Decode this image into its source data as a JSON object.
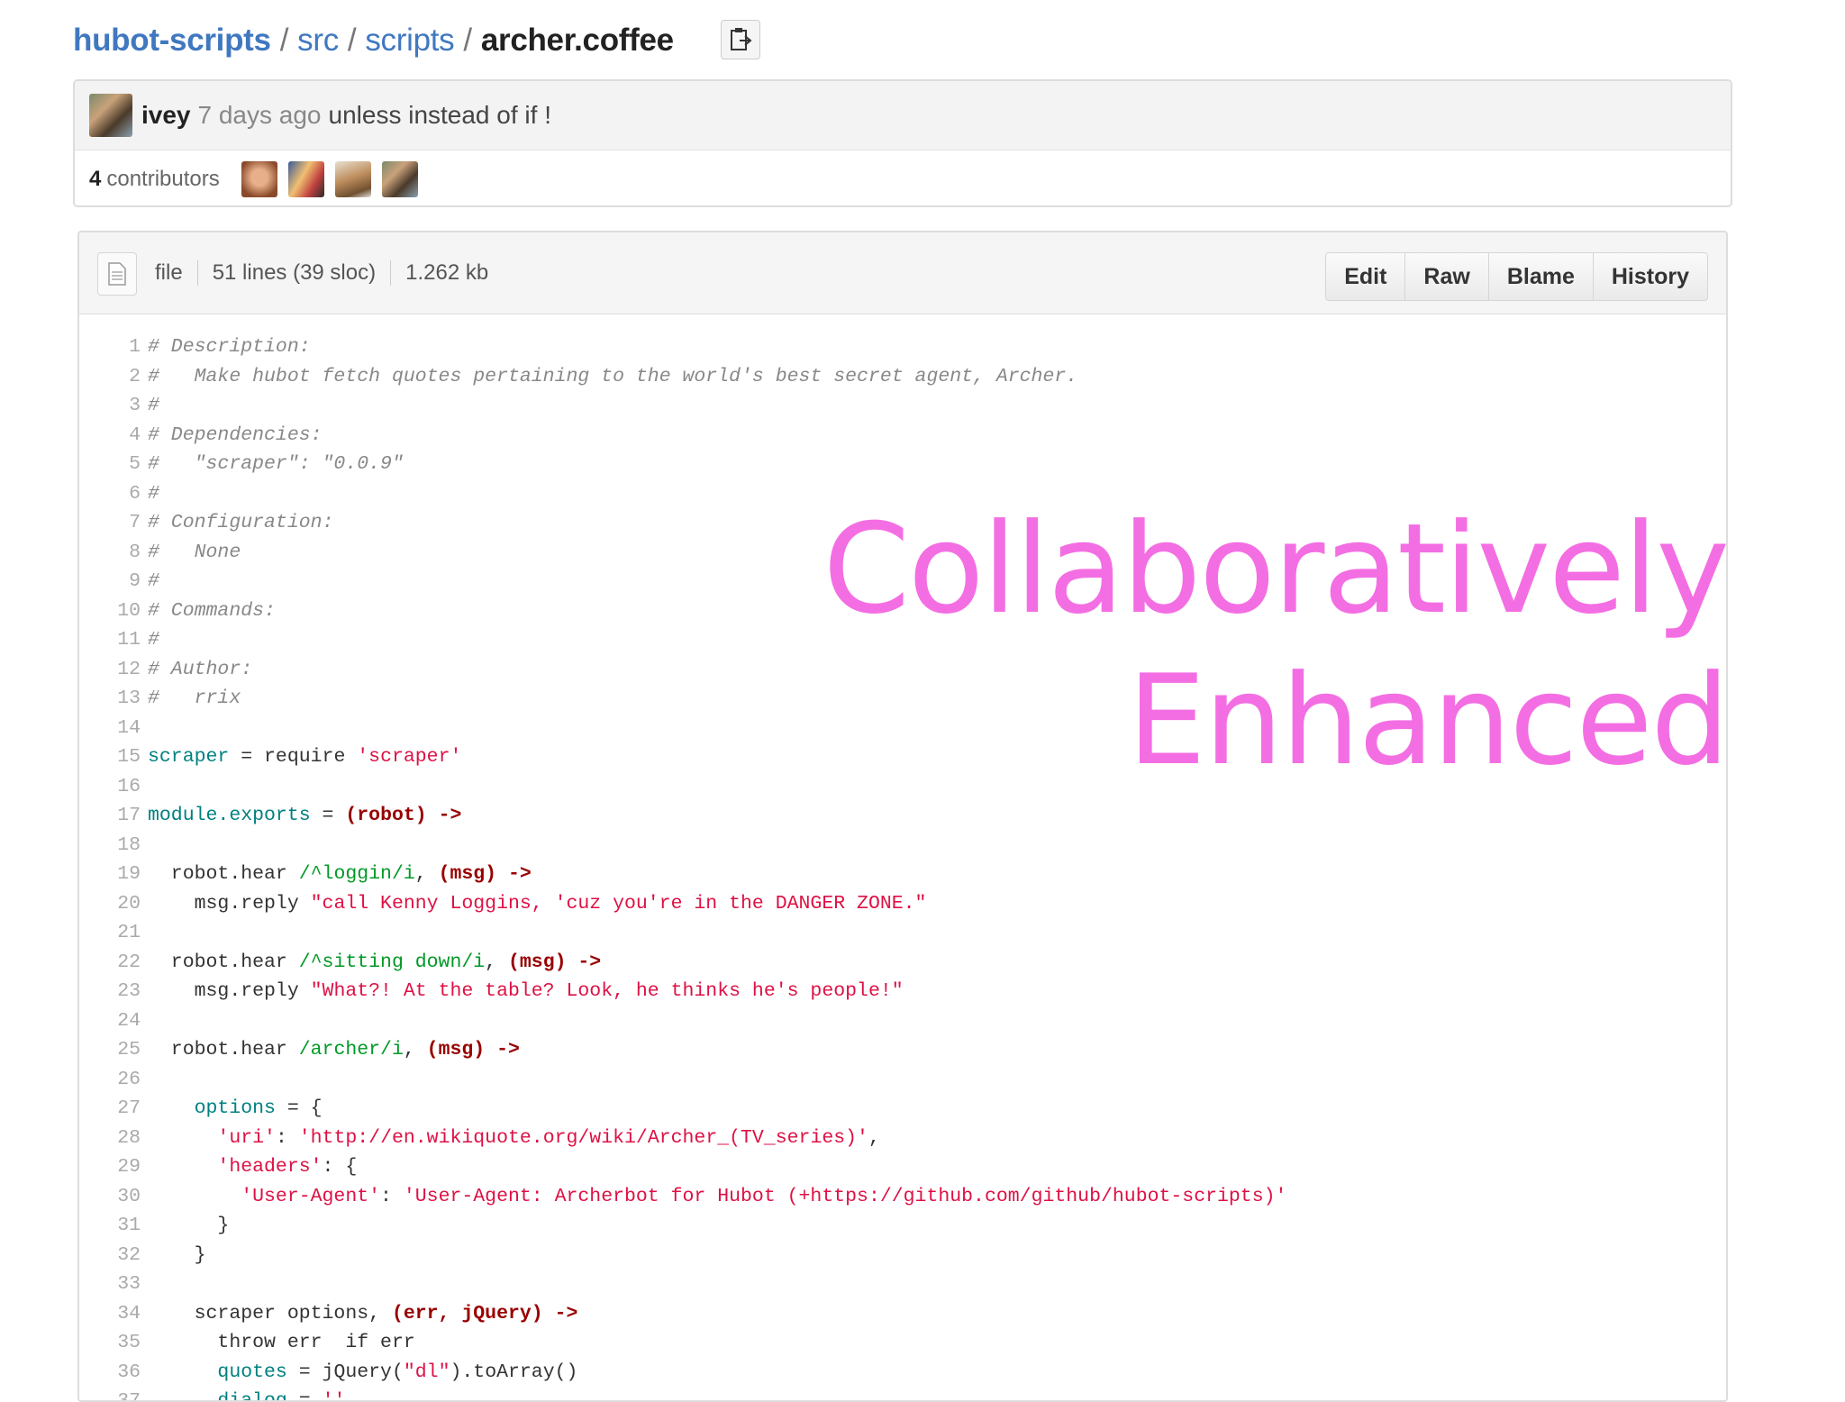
{
  "breadcrumb": {
    "repo": "hubot-scripts",
    "sep": "/",
    "dir1": "src",
    "dir2": "scripts",
    "file": "archer.coffee"
  },
  "commit": {
    "author": "ivey",
    "time": "7 days ago",
    "message": "unless instead of if !"
  },
  "contributors": {
    "count": "4",
    "label": "contributors"
  },
  "file_header": {
    "type": "file",
    "lines": "51 lines (39 sloc)",
    "size": "1.262 kb",
    "buttons": [
      "Edit",
      "Raw",
      "Blame",
      "History"
    ]
  },
  "overlay": {
    "line1": "Collaboratively",
    "line2": "Enhanced"
  },
  "code_lines": [
    [
      [
        "c-comment",
        "# Description:"
      ]
    ],
    [
      [
        "c-comment",
        "#   Make hubot fetch quotes pertaining to the world's best secret agent, Archer."
      ]
    ],
    [
      [
        "c-comment",
        "#"
      ]
    ],
    [
      [
        "c-comment",
        "# Dependencies:"
      ]
    ],
    [
      [
        "c-comment",
        "#   \"scraper\": \"0.0.9\""
      ]
    ],
    [
      [
        "c-comment",
        "#"
      ]
    ],
    [
      [
        "c-comment",
        "# Configuration:"
      ]
    ],
    [
      [
        "c-comment",
        "#   None"
      ]
    ],
    [
      [
        "c-comment",
        "#"
      ]
    ],
    [
      [
        "c-comment",
        "# Commands:"
      ]
    ],
    [
      [
        "c-comment",
        "#"
      ]
    ],
    [
      [
        "c-comment",
        "# Author:"
      ]
    ],
    [
      [
        "c-comment",
        "#   rrix"
      ]
    ],
    [],
    [
      [
        "c-var",
        "scraper"
      ],
      [
        "",
        " = require "
      ],
      [
        "c-str",
        "'scraper'"
      ]
    ],
    [],
    [
      [
        "c-var",
        "module.exports"
      ],
      [
        "",
        " = "
      ],
      [
        "c-fn",
        "(robot) ->"
      ]
    ],
    [],
    [
      [
        "",
        "  robot.hear "
      ],
      [
        "c-regex",
        "/^loggin/i"
      ],
      [
        "",
        ", "
      ],
      [
        "c-fn",
        "(msg) ->"
      ]
    ],
    [
      [
        "",
        "    msg.reply "
      ],
      [
        "c-str",
        "\"call Kenny Loggins, 'cuz you're in the DANGER ZONE.\""
      ]
    ],
    [],
    [
      [
        "",
        "  robot.hear "
      ],
      [
        "c-regex",
        "/^sitting down/i"
      ],
      [
        "",
        ", "
      ],
      [
        "c-fn",
        "(msg) ->"
      ]
    ],
    [
      [
        "",
        "    msg.reply "
      ],
      [
        "c-str",
        "\"What?! At the table? Look, he thinks he's people!\""
      ]
    ],
    [],
    [
      [
        "",
        "  robot.hear "
      ],
      [
        "c-regex",
        "/archer/i"
      ],
      [
        "",
        ", "
      ],
      [
        "c-fn",
        "(msg) ->"
      ]
    ],
    [],
    [
      [
        "",
        "    "
      ],
      [
        "c-var",
        "options"
      ],
      [
        "",
        " = {"
      ]
    ],
    [
      [
        "",
        "      "
      ],
      [
        "c-str",
        "'uri'"
      ],
      [
        "",
        ": "
      ],
      [
        "c-str",
        "'http://en.wikiquote.org/wiki/Archer_(TV_series)'"
      ],
      [
        "",
        ","
      ]
    ],
    [
      [
        "",
        "      "
      ],
      [
        "c-str",
        "'headers'"
      ],
      [
        "",
        ": {"
      ]
    ],
    [
      [
        "",
        "        "
      ],
      [
        "c-str",
        "'User-Agent'"
      ],
      [
        "",
        ": "
      ],
      [
        "c-str",
        "'User-Agent: Archerbot for Hubot (+https://github.com/github/hubot-scripts)'"
      ]
    ],
    [
      [
        "",
        "      }"
      ]
    ],
    [
      [
        "",
        "    }"
      ]
    ],
    [],
    [
      [
        "",
        "    scraper options, "
      ],
      [
        "c-fn",
        "(err, jQuery) ->"
      ]
    ],
    [
      [
        "",
        "      throw err  if err"
      ]
    ],
    [
      [
        "",
        "      "
      ],
      [
        "c-var",
        "quotes"
      ],
      [
        "",
        " = jQuery("
      ],
      [
        "c-str",
        "\"dl\""
      ],
      [
        "",
        ").toArray()"
      ]
    ],
    [
      [
        "",
        "      "
      ],
      [
        "c-var",
        "dialog"
      ],
      [
        "",
        " = "
      ],
      [
        "c-str",
        "''"
      ]
    ]
  ],
  "colors": {
    "link": "#4078c0",
    "overlay": "#f46ee3",
    "comment": "#888888",
    "string": "#dd1144",
    "regex": "#009926",
    "variable": "#008080"
  },
  "icons": [
    "clipboard-icon",
    "file-icon"
  ]
}
